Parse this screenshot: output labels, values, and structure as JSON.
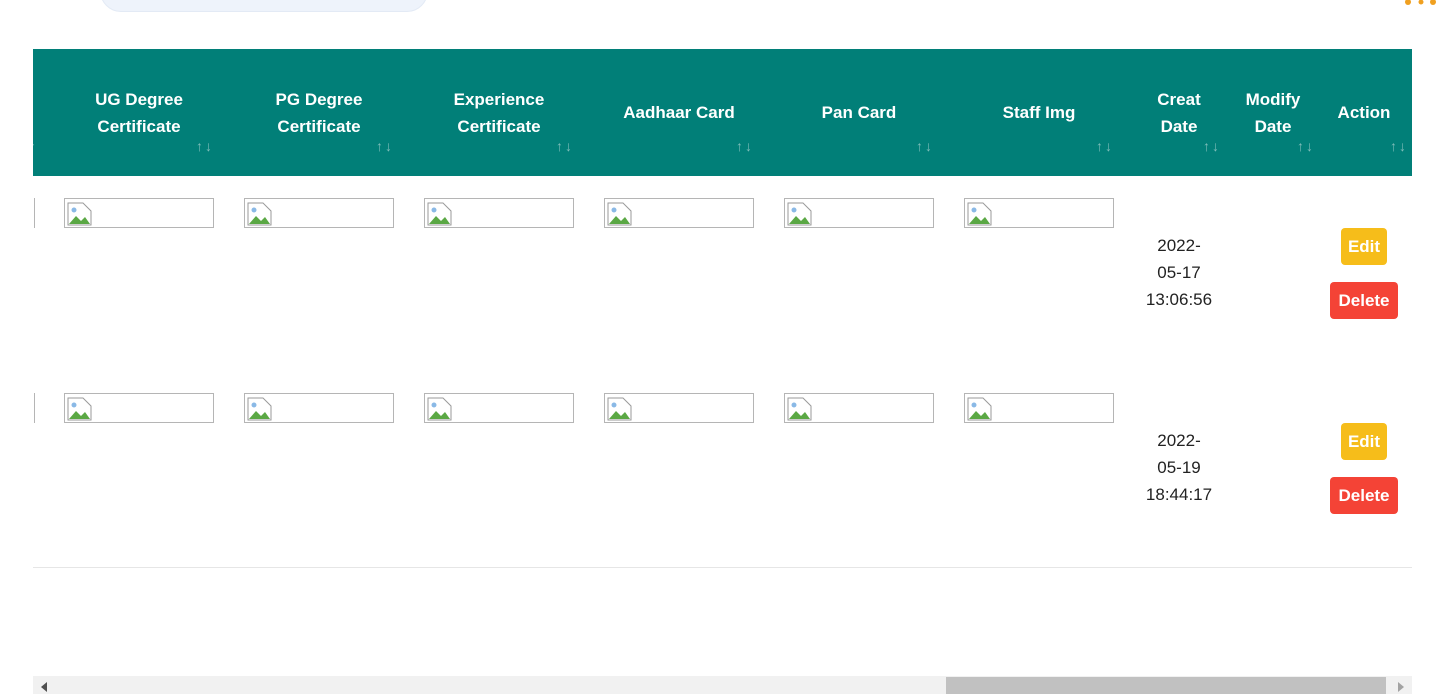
{
  "table": {
    "columns": [
      {
        "label": "UG Degree\nCertificate",
        "sort": "↑↓"
      },
      {
        "label": "PG Degree\nCertificate",
        "sort": "↑↓"
      },
      {
        "label": "Experience\nCertificate",
        "sort": "↑↓"
      },
      {
        "label": "Aadhaar Card",
        "sort": "↑↓"
      },
      {
        "label": "Pan Card",
        "sort": "↑↓"
      },
      {
        "label": "Staff Img",
        "sort": "↑↓"
      },
      {
        "label": "Creat\nDate",
        "sort": "↑↓"
      },
      {
        "label": "Modify\nDate",
        "sort": "↑↓"
      },
      {
        "label": "Action",
        "sort": "↑↓"
      }
    ],
    "partial_column_sort": "↓",
    "rows": [
      {
        "creat_date": "2022-\n05-17\n13:06:56",
        "modify_date": "",
        "edit_label": "Edit",
        "delete_label": "Delete"
      },
      {
        "creat_date": "2022-\n05-19\n18:44:17",
        "modify_date": "",
        "edit_label": "Edit",
        "delete_label": "Delete"
      }
    ]
  },
  "colors": {
    "header_bg": "#017f78",
    "edit_button": "#f6bd1a",
    "delete_button": "#f44336"
  },
  "icons": {
    "broken_image": "broken-image-icon",
    "scroll_left": "arrow-left-icon",
    "scroll_right": "arrow-right-icon"
  }
}
